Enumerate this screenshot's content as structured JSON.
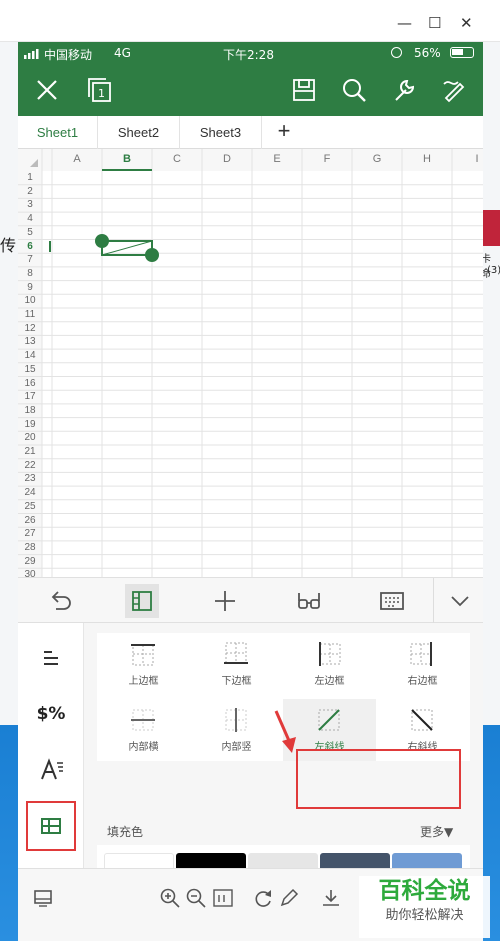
{
  "window": {
    "minimize": "—",
    "maximize": "☐",
    "close": "✕"
  },
  "status": {
    "carrier": "中国移动",
    "network": "4G",
    "time": "下午2:28",
    "battery": "56%"
  },
  "tabs": [
    "Sheet1",
    "Sheet2",
    "Sheet3"
  ],
  "add_tab": "+",
  "grid": {
    "columns": [
      "A",
      "B",
      "C",
      "D",
      "E",
      "F",
      "G",
      "H",
      "I"
    ],
    "rows": [
      "1",
      "2",
      "3",
      "4",
      "5",
      "6",
      "7",
      "8",
      "9",
      "10",
      "11",
      "12",
      "13",
      "14",
      "15",
      "16",
      "17",
      "18",
      "19",
      "20",
      "21",
      "22",
      "23",
      "24",
      "25",
      "26",
      "27",
      "28",
      "29",
      "30"
    ],
    "selected_column": "B",
    "selected_row": "6"
  },
  "borders": [
    {
      "label": "上边框"
    },
    {
      "label": "下边框"
    },
    {
      "label": "左边框"
    },
    {
      "label": "右边框"
    },
    {
      "label": "内部横"
    },
    {
      "label": "内部竖"
    },
    {
      "label": "左斜线"
    },
    {
      "label": "右斜线"
    }
  ],
  "fill": {
    "label": "填充色",
    "more": "更多▼",
    "colors": [
      "#ffffff",
      "#000000",
      "#e6e6e6",
      "#44546a",
      "#6f9bd4",
      "#e0823f",
      "#a5a5a5",
      "#f5c243",
      "#4e7ac7",
      "#72ac4d"
    ]
  },
  "side": {
    "format_symbol": "$%"
  },
  "desktop": {
    "left_char": "传",
    "right_text": "卡命",
    "right_text2": "(3)"
  },
  "watermark": {
    "title": "百科全说",
    "subtitle": "助你轻松解决"
  },
  "colors": {
    "brand": "#2e7d43",
    "highlight": "#e03a3a"
  }
}
